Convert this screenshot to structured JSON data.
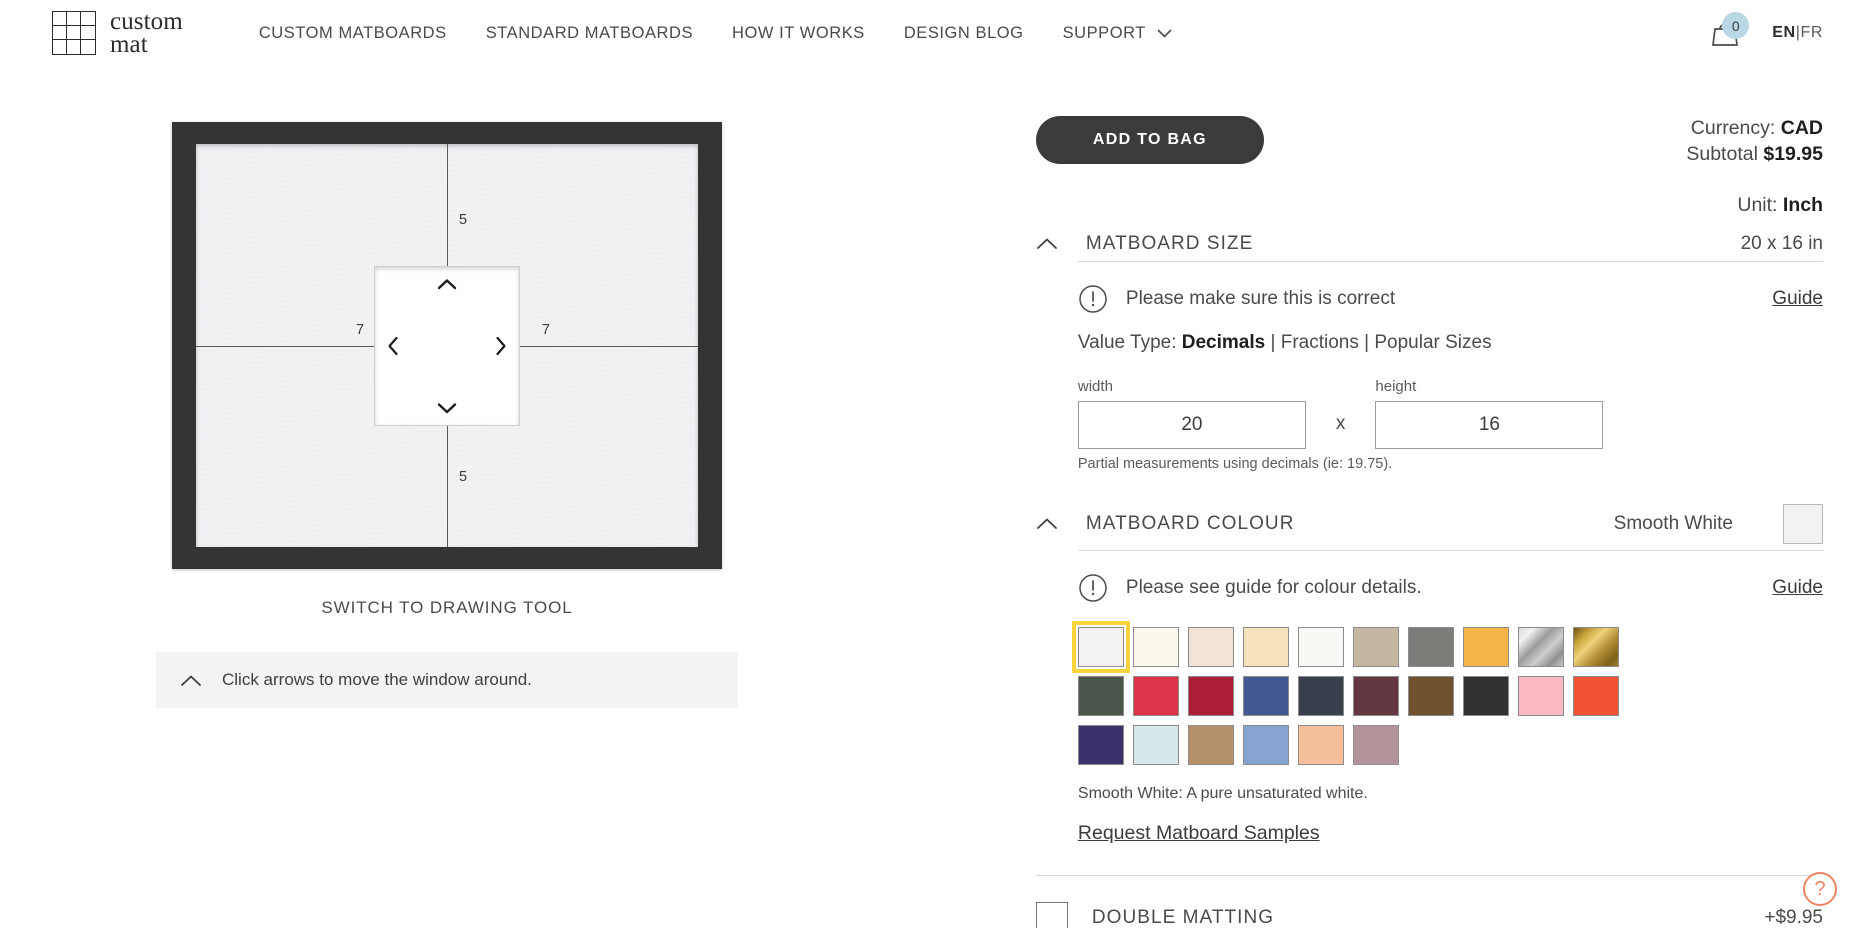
{
  "header": {
    "brand": {
      "line1": "custom",
      "line2": "mat",
      "logo_icon": "grid-logo-icon"
    },
    "nav": [
      {
        "label": "CUSTOM MATBOARDS",
        "has_caret": false
      },
      {
        "label": "STANDARD MATBOARDS",
        "has_caret": false
      },
      {
        "label": "HOW IT WORKS",
        "has_caret": false
      },
      {
        "label": "DESIGN BLOG",
        "has_caret": false
      },
      {
        "label": "SUPPORT",
        "has_caret": true
      }
    ],
    "cart": {
      "icon": "shopping-bag-icon",
      "count": "0"
    },
    "language": {
      "active": "EN",
      "separator": "|",
      "inactive": "FR"
    }
  },
  "preview": {
    "margin_top": "5",
    "margin_bottom": "5",
    "margin_left": "7",
    "margin_right": "7",
    "arrows": {
      "up": "chevron-up-icon",
      "down": "chevron-down-icon",
      "left": "chevron-left-icon",
      "right": "chevron-right-icon"
    },
    "switch_tool_label": "SWITCH TO DRAWING TOOL",
    "hint": "Click arrows to move the window around.",
    "frame_color": "#343434",
    "mat_color": "#f3f1f4"
  },
  "order": {
    "add_to_bag": "ADD TO BAG",
    "currency_label": "Currency:",
    "currency_value": "CAD",
    "subtotal_label": "Subtotal",
    "subtotal_value": "$19.95",
    "unit_label": "Unit:",
    "unit_value": "Inch"
  },
  "matboard_size": {
    "title": "MATBOARD SIZE",
    "summary": "20 x 16 in",
    "notice": "Please make sure this is correct",
    "guide_link": "Guide",
    "value_type_label": "Value Type:",
    "value_types": [
      "Decimals",
      "Fractions",
      "Popular Sizes"
    ],
    "value_type_active": "Decimals",
    "width_label": "width",
    "width_value": "20",
    "times": "x",
    "height_label": "height",
    "height_value": "16",
    "hint": "Partial measurements using decimals (ie: 19.75)."
  },
  "matboard_colour": {
    "title": "MATBOARD COLOUR",
    "selected_name": "Smooth White",
    "selected_hex": "#f3f1f4",
    "notice": "Please see guide for colour details.",
    "guide_link": "Guide",
    "description": "Smooth White: A pure unsaturated white.",
    "samples_link": "Request Matboard Samples",
    "selected_outline": "#fbd33c",
    "rows": [
      [
        {
          "hex": "#f3f1f4",
          "selected": true,
          "metallic": ""
        },
        {
          "hex": "#fcf8ee",
          "selected": false,
          "metallic": ""
        },
        {
          "hex": "#f0e2d6",
          "selected": false,
          "metallic": ""
        },
        {
          "hex": "#f6e3bb",
          "selected": false,
          "metallic": ""
        },
        {
          "hex": "#f9f8f4",
          "selected": false,
          "metallic": ""
        },
        {
          "hex": "#c5b79f",
          "selected": false,
          "metallic": ""
        },
        {
          "hex": "#7c7c79",
          "selected": false,
          "metallic": ""
        },
        {
          "hex": "#f5b44a",
          "selected": false,
          "metallic": ""
        },
        {
          "hex": "#bdbdbd",
          "selected": false,
          "metallic": "silver"
        },
        {
          "hex": "#9c7c26",
          "selected": false,
          "metallic": "gold"
        }
      ],
      [
        {
          "hex": "#4a564b",
          "selected": false,
          "metallic": ""
        },
        {
          "hex": "#db3449",
          "selected": false,
          "metallic": ""
        },
        {
          "hex": "#ac1e35",
          "selected": false,
          "metallic": ""
        },
        {
          "hex": "#41598f",
          "selected": false,
          "metallic": ""
        },
        {
          "hex": "#3a3f4e",
          "selected": false,
          "metallic": ""
        },
        {
          "hex": "#623840",
          "selected": false,
          "metallic": ""
        },
        {
          "hex": "#70512f",
          "selected": false,
          "metallic": ""
        },
        {
          "hex": "#323232",
          "selected": false,
          "metallic": ""
        },
        {
          "hex": "#f8b9c3",
          "selected": false,
          "metallic": ""
        },
        {
          "hex": "#f15232",
          "selected": false,
          "metallic": ""
        }
      ],
      [
        {
          "hex": "#3b3068",
          "selected": false,
          "metallic": ""
        },
        {
          "hex": "#d7e7e9",
          "selected": false,
          "metallic": ""
        },
        {
          "hex": "#b4916a",
          "selected": false,
          "metallic": ""
        },
        {
          "hex": "#84a4cd",
          "selected": false,
          "metallic": ""
        },
        {
          "hex": "#f5bf9a",
          "selected": false,
          "metallic": ""
        },
        {
          "hex": "#b19399",
          "selected": false,
          "metallic": ""
        }
      ]
    ]
  },
  "double_matting": {
    "title": "DOUBLE MATTING",
    "price": "+$9.95",
    "checked": false
  },
  "help": {
    "icon": "question-mark-icon",
    "color": "#ef8468"
  }
}
